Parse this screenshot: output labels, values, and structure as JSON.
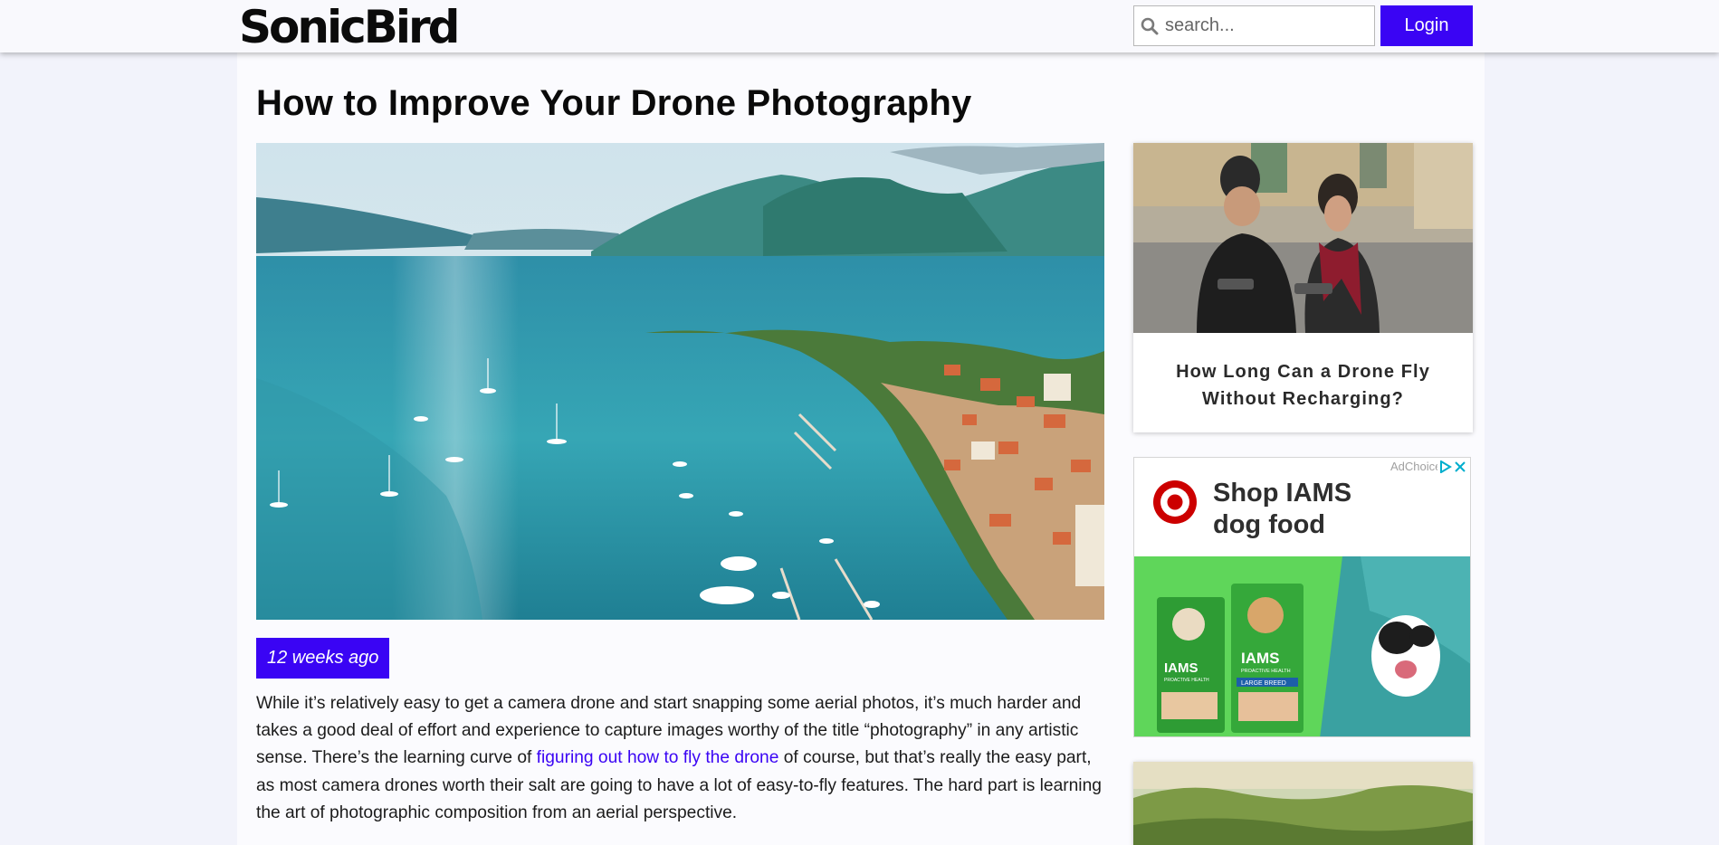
{
  "header": {
    "logo_text": "SonicBird",
    "search_placeholder": "search...",
    "login_label": "Login"
  },
  "article": {
    "title": "How to Improve Your Drone Photography",
    "date": "12 weeks ago",
    "paragraph": {
      "before_link": "While it’s relatively easy to get a camera drone and start snapping some aerial photos, it’s much harder and takes a good deal of effort and experience to capture images worthy of the title “photography” in any artistic sense. There’s the learning curve of ",
      "link_text": "figuring out how to fly the drone",
      "after_link": " of course, but that’s really the easy part, as most camera drones worth their salt are going to have a lot of easy-to-fly features. The hard part is learning the art of photographic composition from an aerial perspective."
    }
  },
  "sidebar": {
    "related_title": "How Long Can a Drone Fly Without Recharging?",
    "ad": {
      "choices_label": "AdChoices",
      "headline_line1": "Shop IAMS",
      "headline_line2": "dog food",
      "product_brand": "IAMS",
      "product_line": "PROACTIVE HEALTH",
      "product_variant": "LARGE BREED"
    }
  },
  "colors": {
    "accent": "#3a04f4",
    "page_bg": "#f2f3fb",
    "panel_bg": "#fbfbfe"
  },
  "icons": {
    "search": "magnifier-icon",
    "ad_choices": "adchoices-triangle-icon",
    "ad_close": "close-icon",
    "target": "target-bullseye-icon"
  }
}
